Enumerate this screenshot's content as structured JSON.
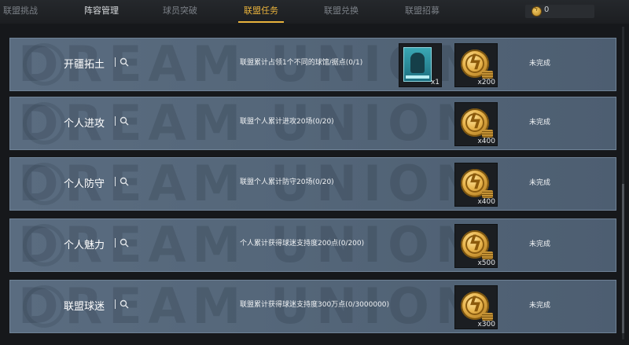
{
  "tabs": [
    {
      "label": "联盟挑战",
      "state": "dim"
    },
    {
      "label": "阵容管理",
      "state": "bright"
    },
    {
      "label": "球员突破",
      "state": "dim"
    },
    {
      "label": "联盟任务",
      "state": "active"
    },
    {
      "label": "联盟兑换",
      "state": "dim"
    },
    {
      "label": "联盟招募",
      "state": "dim"
    }
  ],
  "currency": {
    "icon": "coin-icon",
    "value": "0"
  },
  "watermark": "DREAM UNION",
  "tasks": [
    {
      "title": "开疆拓土",
      "description": "联盟累计占领1个不同的球馆/据点(0/1)",
      "rewards": [
        {
          "type": "player-card",
          "qty": "x1"
        },
        {
          "type": "gold-coin",
          "qty": "x200"
        }
      ],
      "status": "未完成"
    },
    {
      "title": "个人进攻",
      "description": "联盟个人累计进攻20场(0/20)",
      "rewards": [
        {
          "type": "gold-coin",
          "qty": "x400"
        }
      ],
      "status": "未完成"
    },
    {
      "title": "个人防守",
      "description": "联盟个人累计防守20场(0/20)",
      "rewards": [
        {
          "type": "gold-coin",
          "qty": "x400"
        }
      ],
      "status": "未完成"
    },
    {
      "title": "个人魅力",
      "description": "个人累计获得球迷支持度200点(0/200)",
      "rewards": [
        {
          "type": "gold-coin",
          "qty": "x500"
        }
      ],
      "status": "未完成"
    },
    {
      "title": "联盟球迷",
      "description": "联盟累计获得球迷支持度300万点(0/3000000)",
      "rewards": [
        {
          "type": "gold-coin",
          "qty": "x300"
        }
      ],
      "status": "未完成"
    }
  ],
  "colors": {
    "accent": "#e8b23c",
    "row_bg": "#55677a",
    "page_bg": "#16181b"
  }
}
